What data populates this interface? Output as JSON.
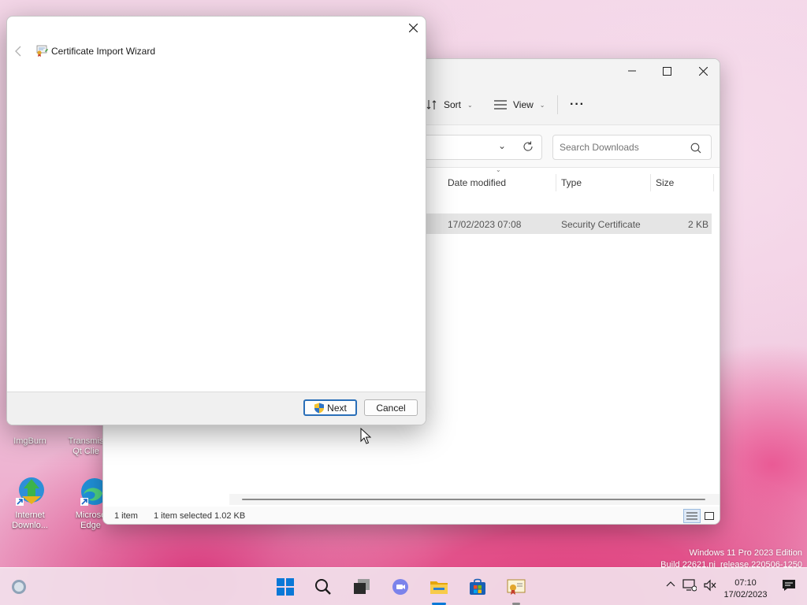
{
  "desktop": {
    "icons": [
      {
        "label": "ImgBurn"
      },
      {
        "label": "Transmis Qt Clie"
      },
      {
        "label": "Internet Downlo..."
      },
      {
        "label": "Microso Edge"
      }
    ],
    "watermark": {
      "line1": "Windows 11 Pro 2023 Edition",
      "line2": "Build 22621.ni_release.220506-1250"
    }
  },
  "explorer": {
    "toolbar": {
      "sort_label": "Sort",
      "view_label": "View",
      "more_label": "···"
    },
    "search": {
      "placeholder": "Search Downloads"
    },
    "columns": [
      "Date modified",
      "Type",
      "Size"
    ],
    "rows": [
      {
        "date": "17/02/2023 07:08",
        "type": "Security Certificate",
        "size": "2 KB"
      }
    ],
    "status": {
      "count": "1 item",
      "selection": "1 item selected  1.02 KB"
    }
  },
  "wizard": {
    "title": "Certificate Import Wizard",
    "next_label": "Next",
    "cancel_label": "Cancel"
  },
  "taskbar": {
    "time": "07:10",
    "date": "17/02/2023"
  },
  "colors": {
    "accent": "#2a6fb8",
    "taskbar": "#f2e1ec"
  }
}
